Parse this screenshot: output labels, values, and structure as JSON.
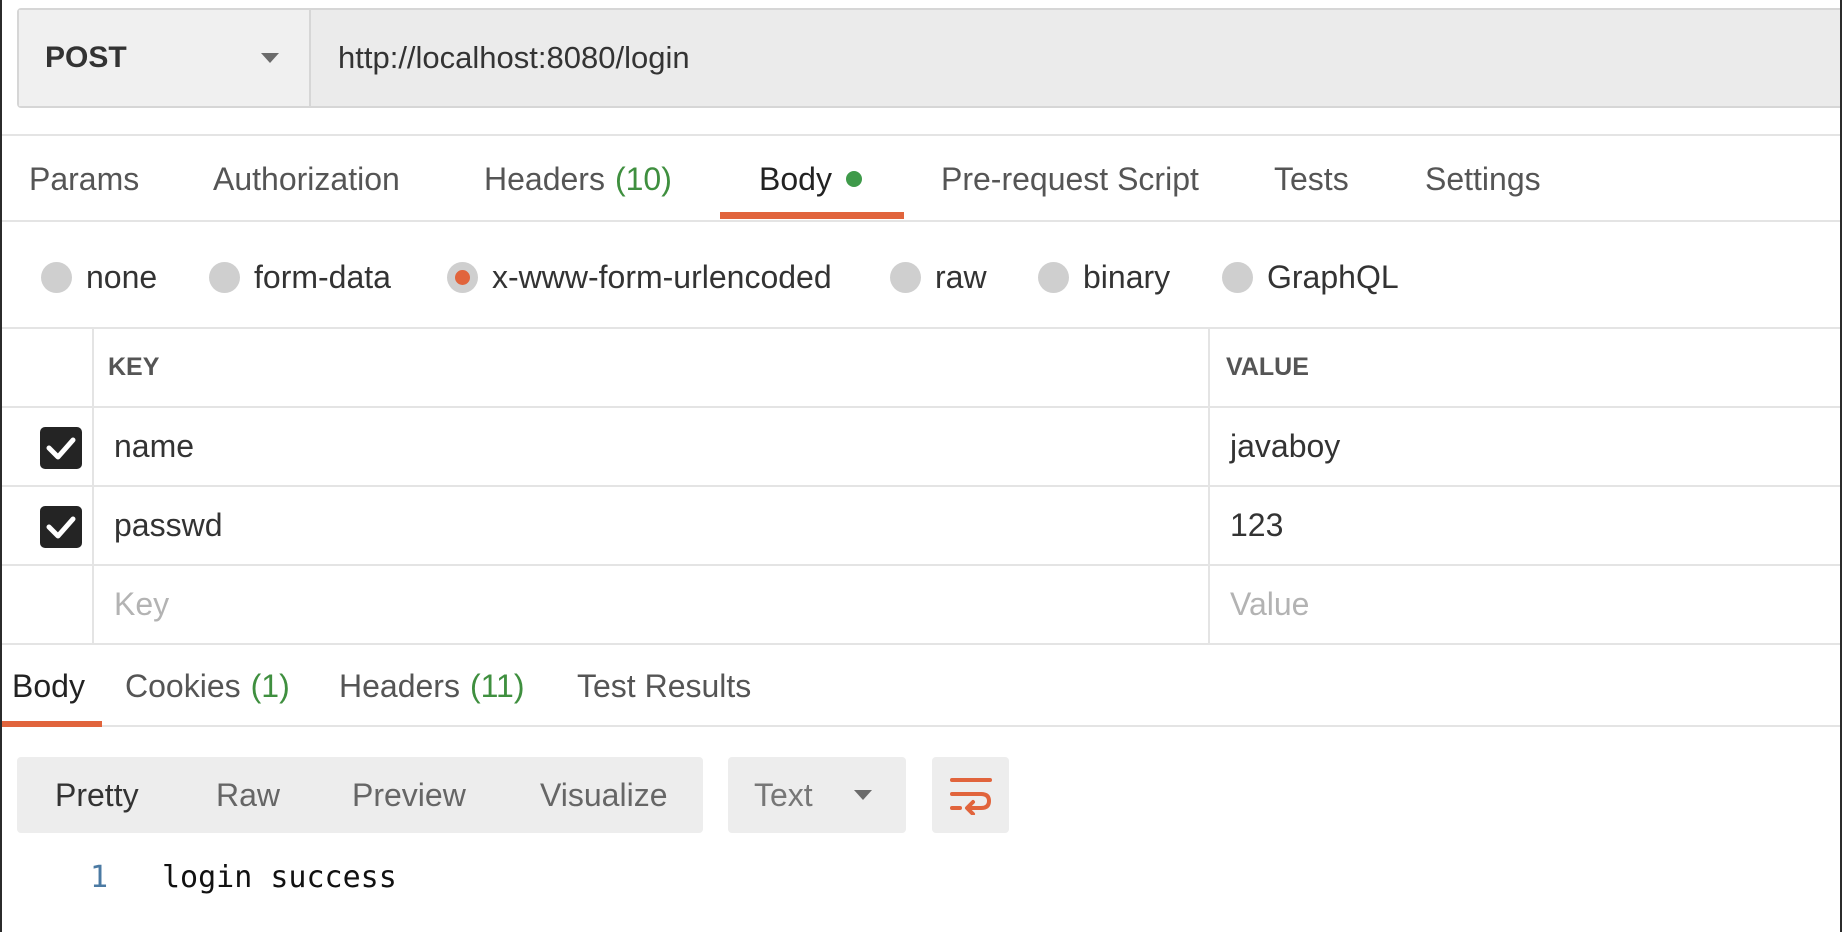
{
  "request": {
    "method": "POST",
    "url": "http://localhost:8080/login"
  },
  "request_tabs": [
    {
      "label": "Params"
    },
    {
      "label": "Authorization"
    },
    {
      "label": "Headers",
      "count": "(10)"
    },
    {
      "label": "Body",
      "active": true
    },
    {
      "label": "Pre-request Script"
    },
    {
      "label": "Tests"
    },
    {
      "label": "Settings"
    }
  ],
  "body_types": [
    {
      "label": "none"
    },
    {
      "label": "form-data"
    },
    {
      "label": "x-www-form-urlencoded",
      "selected": true
    },
    {
      "label": "raw"
    },
    {
      "label": "binary"
    },
    {
      "label": "GraphQL"
    }
  ],
  "params_table": {
    "headers": {
      "key": "KEY",
      "value": "VALUE"
    },
    "rows": [
      {
        "checked": true,
        "key": "name",
        "value": "javaboy"
      },
      {
        "checked": true,
        "key": "passwd",
        "value": "123"
      }
    ],
    "placeholder": {
      "key": "Key",
      "value": "Value"
    }
  },
  "response_tabs": [
    {
      "label": "Body",
      "active": true
    },
    {
      "label": "Cookies",
      "count": "(1)"
    },
    {
      "label": "Headers",
      "count": "(11)"
    },
    {
      "label": "Test Results"
    }
  ],
  "view_modes": [
    "Pretty",
    "Raw",
    "Preview",
    "Visualize"
  ],
  "format_select": "Text",
  "response_body": {
    "line_number": "1",
    "text": "login success"
  },
  "colors": {
    "accent": "#e1643c",
    "count_green": "#3f8f3f",
    "status_dot": "#3f9a4a"
  },
  "icons": [
    "chevron-down-icon",
    "checkbox-checked-icon",
    "wrap-lines-icon"
  ]
}
